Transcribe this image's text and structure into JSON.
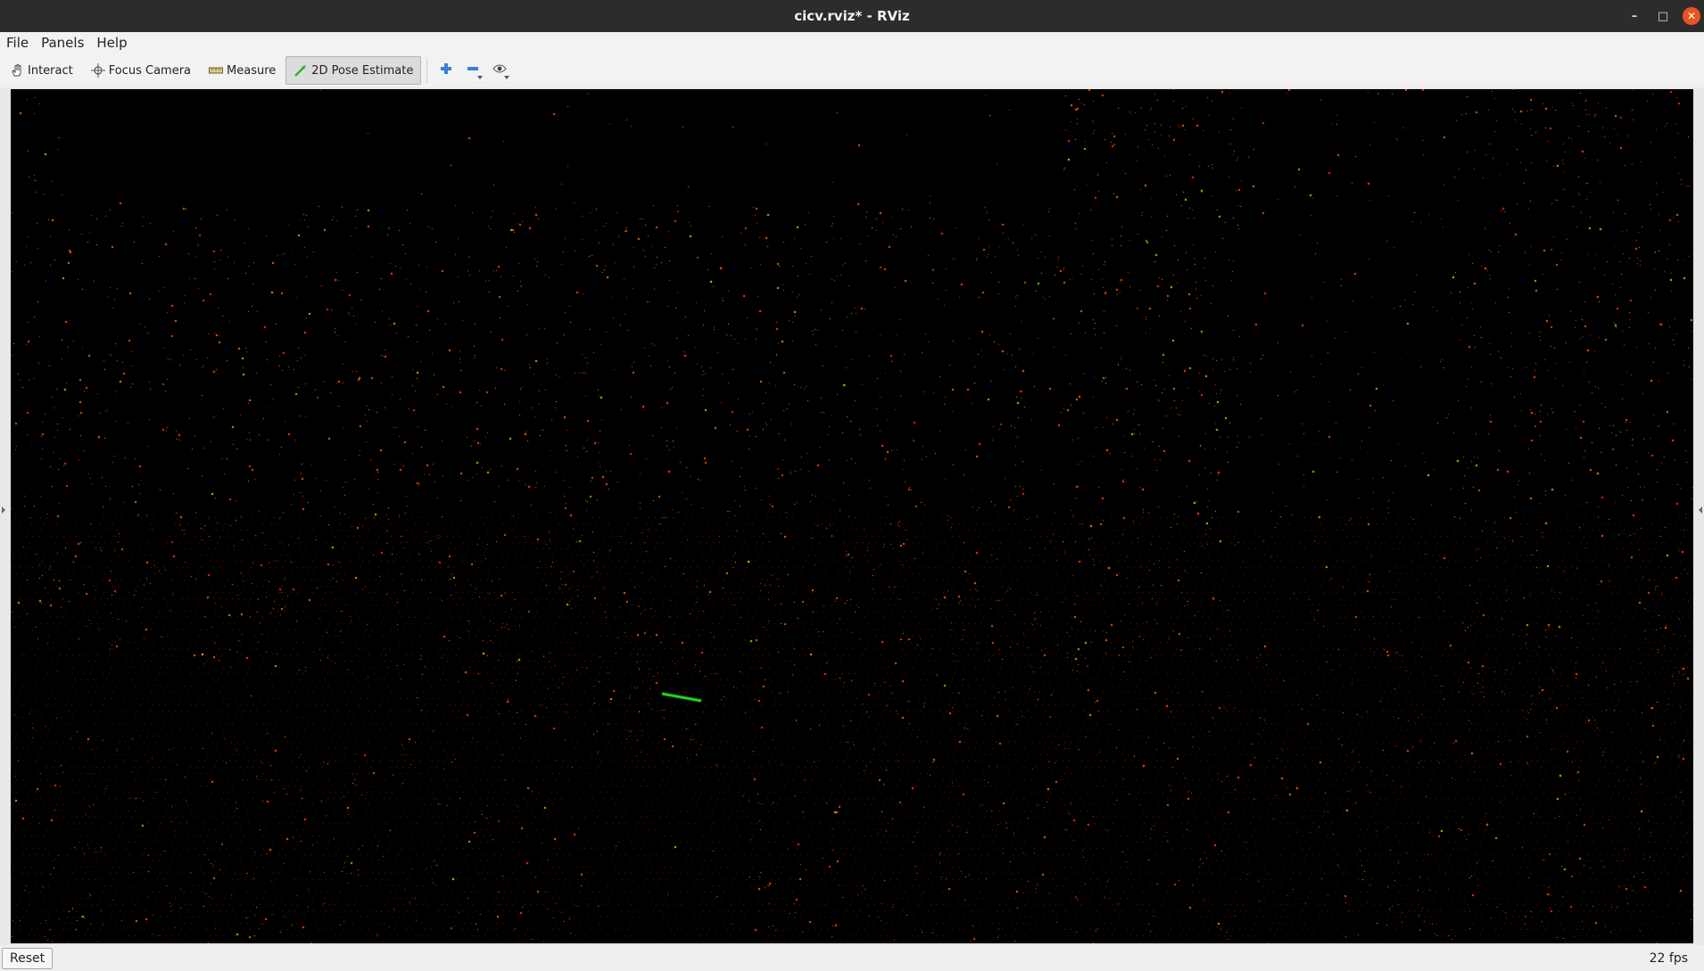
{
  "window": {
    "title": "cicv.rviz* - RViz",
    "minimize_glyph": "–",
    "maximize_glyph": "□",
    "close_glyph": "✕"
  },
  "menu": {
    "items": [
      {
        "label": "File"
      },
      {
        "label": "Panels"
      },
      {
        "label": "Help"
      }
    ]
  },
  "toolbar": {
    "tools": [
      {
        "label": "Interact",
        "icon": "hand-icon",
        "active": false
      },
      {
        "label": "Focus Camera",
        "icon": "crosshair-icon",
        "active": false
      },
      {
        "label": "Measure",
        "icon": "ruler-icon",
        "active": false
      },
      {
        "label": "2D Pose Estimate",
        "icon": "green-arrow-icon",
        "active": true
      }
    ],
    "extra_icons": [
      "add-icon",
      "remove-icon",
      "eye-icon"
    ]
  },
  "viewport": {
    "background": "#000000",
    "point_colors": [
      "#ff4d00",
      "#ff6a00",
      "#ff3300",
      "#ffa000",
      "#d9c400",
      "#9ec800",
      "#ffd000"
    ],
    "pose_arrow_color": "#27e21e"
  },
  "status": {
    "reset_label": "Reset",
    "fps": "22 fps"
  }
}
